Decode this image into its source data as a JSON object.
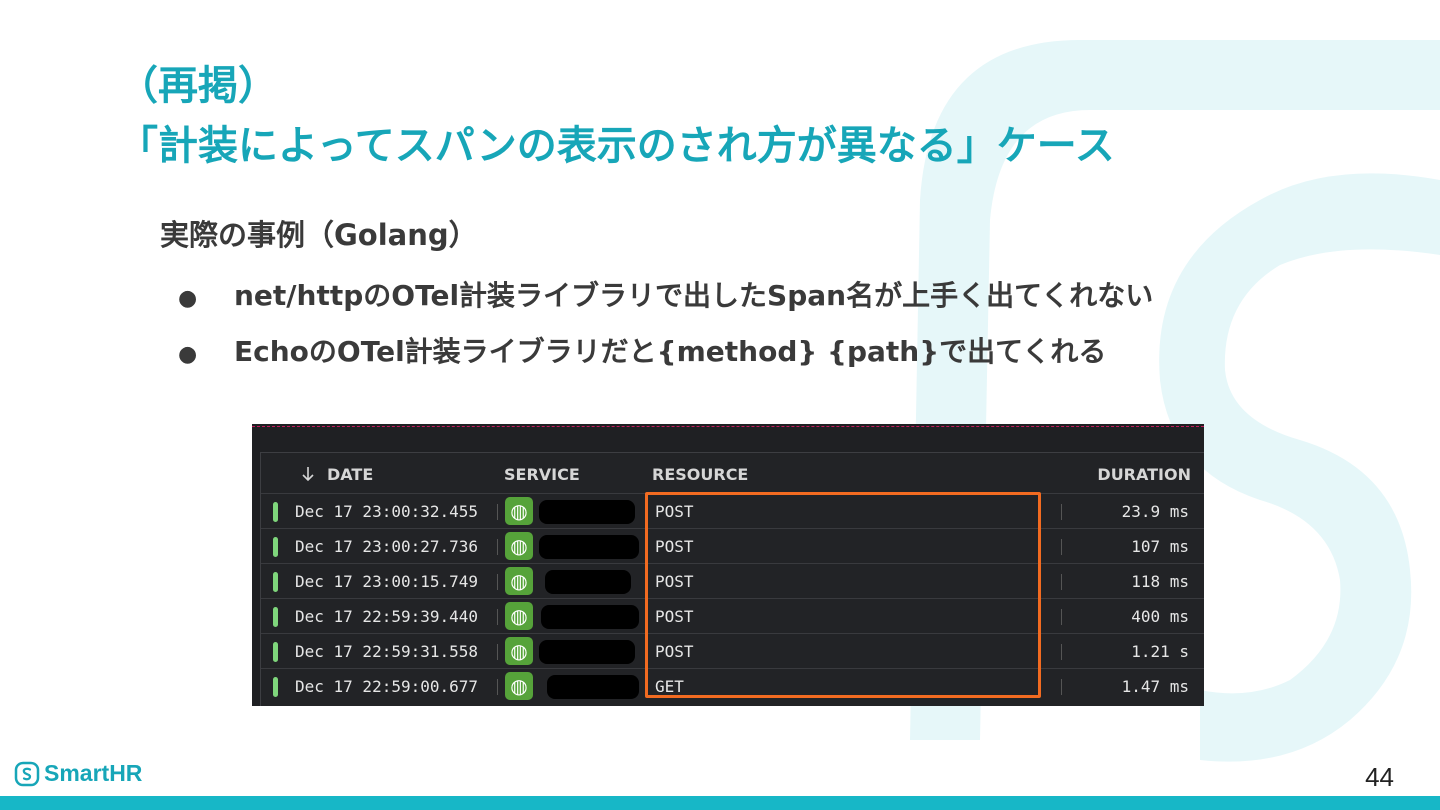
{
  "slide": {
    "title_line1": "（再掲）",
    "title_line2": "「計装によってスパンの表示のされ方が異なる」ケース",
    "subtitle": "実際の事例（Golang）",
    "bullets": [
      "net/httpのOTel計装ライブラリで出したSpan名が上手く出てくれない",
      "EchoのOTel計装ライブラリだと{method} {path}で出てくれる"
    ],
    "page_number": "44",
    "bullet_glyph": "●"
  },
  "logo": {
    "text": "SmartHR",
    "icon": "smarthr-s-icon"
  },
  "colors": {
    "accent": "#17a6b8",
    "footer_bar": "#17b7c7",
    "highlight": "#f26b21",
    "status_ok": "#7fd67c",
    "service_icon_bg": "#56a33a"
  },
  "table": {
    "sort_icon": "arrow-down-icon",
    "headers": {
      "date": "DATE",
      "service": "SERVICE",
      "resource": "RESOURCE",
      "duration": "DURATION"
    },
    "rows": [
      {
        "date": "Dec 17 23:00:32.455",
        "service_icon": "globe-icon",
        "resource": "POST",
        "duration": "23.9 ms"
      },
      {
        "date": "Dec 17 23:00:27.736",
        "service_icon": "globe-icon",
        "resource": "POST",
        "duration": "107 ms"
      },
      {
        "date": "Dec 17 23:00:15.749",
        "service_icon": "globe-icon",
        "resource": "POST",
        "duration": "118 ms"
      },
      {
        "date": "Dec 17 22:59:39.440",
        "service_icon": "globe-icon",
        "resource": "POST",
        "duration": "400 ms"
      },
      {
        "date": "Dec 17 22:59:31.558",
        "service_icon": "globe-icon",
        "resource": "POST",
        "duration": "1.21 s"
      },
      {
        "date": "Dec 17 22:59:00.677",
        "service_icon": "globe-icon",
        "resource": "GET",
        "duration": "1.47 ms"
      }
    ]
  }
}
